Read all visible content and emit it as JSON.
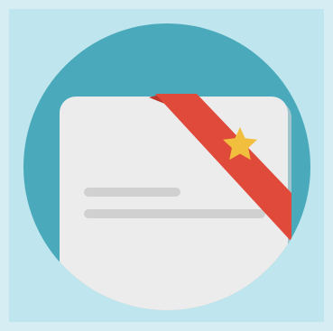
{
  "icon": {
    "name": "bookmarked-document-icon",
    "colors": {
      "background": "#bfe6ee",
      "frame": "#d6eef3",
      "circle": "#4aaabb",
      "card": "#ececec",
      "card_shadow": "#d7d7d7",
      "line": "#d0d0d0",
      "ribbon": "#e04a3a",
      "ribbon_dark": "#b9372b",
      "star": "#f2be3e"
    }
  }
}
